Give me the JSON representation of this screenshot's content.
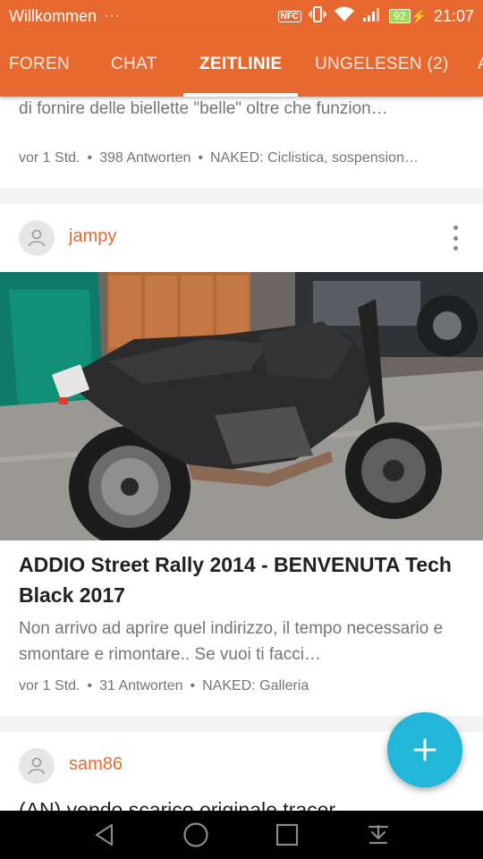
{
  "status_bar": {
    "app_name": "Willkommen",
    "more": "···",
    "nfc": "NFC",
    "battery": "92",
    "time": "21:07"
  },
  "tabs": [
    {
      "label": "FOREN",
      "active": false
    },
    {
      "label": "CHAT",
      "active": false
    },
    {
      "label": "ZEITLINIE",
      "active": true
    },
    {
      "label": "UNGELESEN (2)",
      "active": false
    },
    {
      "label": "A",
      "active": false
    }
  ],
  "posts": [
    {
      "excerpt": "Grazie a te/voi della fiducia che mi date/avete dato.Al fine di fornire delle biellette \"belle\" oltre che funzion…",
      "time": "vor 1 Std.",
      "replies": "398 Antworten",
      "forum": "NAKED: Ciclistica, sospension…"
    },
    {
      "author": "jampy",
      "title": "ADDIO Street Rally 2014 - BENVENUTA Tech Black 2017",
      "excerpt": "Non arrivo ad aprire quel indirizzo, il tempo necessario e smontare e rimontare.. Se vuoi ti facci…",
      "time": "vor 1 Std.",
      "replies": "31 Antworten",
      "forum": "NAKED: Galleria"
    },
    {
      "author": "sam86",
      "title": "(AN) vendo scarico originale tracer"
    }
  ],
  "meta_separator": "•",
  "colors": {
    "accent": "#e8692f",
    "fab": "#22b6d9",
    "text_primary": "#212121",
    "text_secondary": "#757575"
  }
}
